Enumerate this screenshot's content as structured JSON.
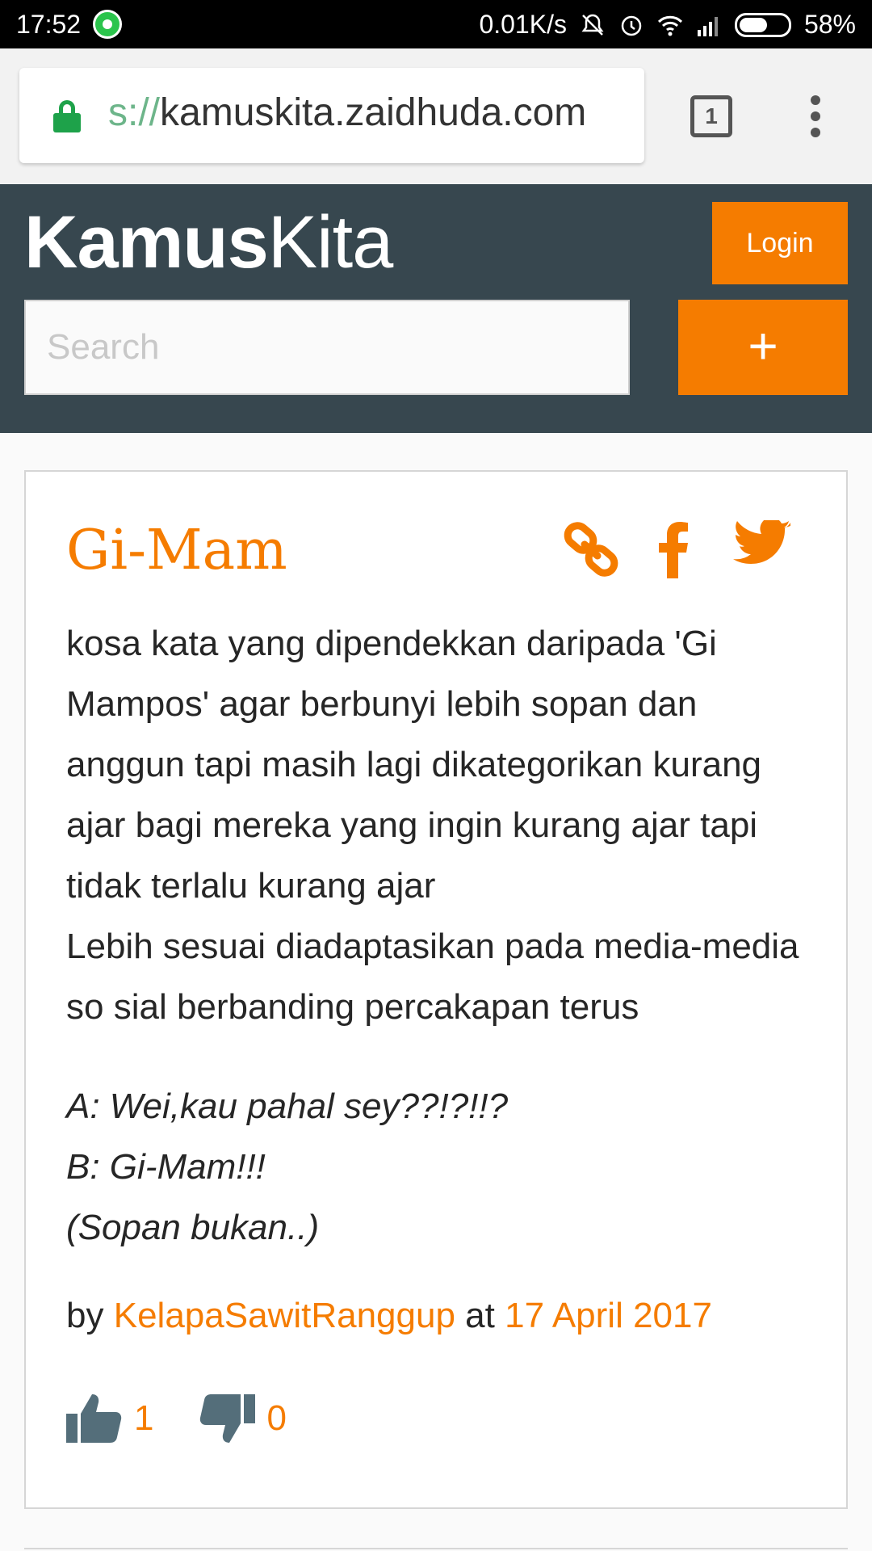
{
  "status_bar": {
    "time": "17:52",
    "network_speed": "0.01K/s",
    "battery_percent": "58%",
    "battery_level": 0.58,
    "icons": [
      "whatsapp-icon",
      "mute-icon",
      "alarm-icon",
      "wifi-icon",
      "signal-icon",
      "battery-icon"
    ]
  },
  "browser": {
    "url_scheme": "s://",
    "url_host": "kamuskita.zaidhuda.com",
    "tab_count": "1"
  },
  "site": {
    "logo_bold": "Kamus",
    "logo_light": "Kita",
    "login_label": "Login",
    "search_placeholder": "Search",
    "add_label": "+"
  },
  "entry": {
    "word": "Gi-Mam",
    "definition": "kosa kata yang dipendekkan daripada 'Gi Mampos' agar berbunyi lebih sopan dan anggun tapi masih lagi dikategorikan kurang ajar bagi mereka yang ingin kurang ajar tapi tidak terlalu kurang ajar\nLebih sesuai diadaptasikan pada media-media so sial berbanding percakapan terus",
    "example": "A: Wei,kau pahal sey??!?!!?\nB: Gi-Mam!!!\n(Sopan bukan..)",
    "by_label": "by",
    "author": "KelapaSawitRanggup",
    "at_label": "at",
    "date": "17 April 2017",
    "upvotes": "1",
    "downvotes": "0"
  },
  "colors": {
    "accent": "#f57c00",
    "header_bg": "#37474f",
    "vote_icon": "#546e7a"
  }
}
